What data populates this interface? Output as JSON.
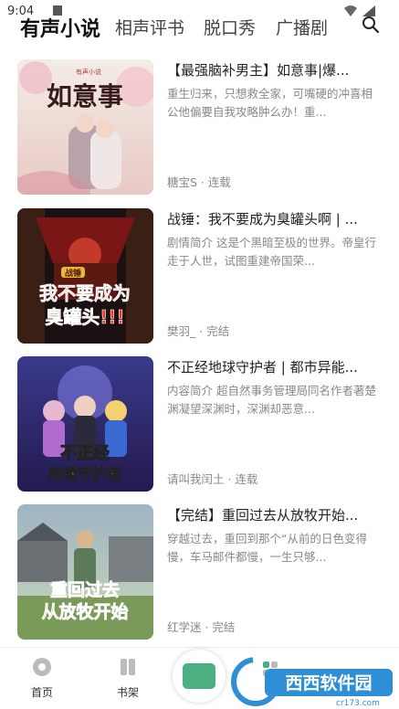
{
  "status_bar": {
    "time": "9:04"
  },
  "tabs": [
    {
      "label": "有声小说",
      "active": true
    },
    {
      "label": "相声评书",
      "active": false
    },
    {
      "label": "脱口秀",
      "active": false
    },
    {
      "label": "广播剧",
      "active": false
    }
  ],
  "books": [
    {
      "title": "【最强脑补男主】如意事|爆...",
      "description": "重生归来，只想救全家，可嘴硬的冲喜相公他偏要自我攻略肿么办！重...",
      "meta": "糖宝S · 连载",
      "cover_text": "如意事",
      "cover_tag": "有声小说"
    },
    {
      "title": "战锤：我不要成为臭罐头啊 | ...",
      "description": "剧情简介 这是个黑暗至极的世界。帝皇行走于人世，试图重建帝国荣...",
      "meta": "樊羽_ · 完结",
      "cover_text_top": "战锤",
      "cover_text_mid": "我不要成为",
      "cover_text_bottom": "臭罐头!!!"
    },
    {
      "title": "不正经地球守护者 | 都市异能...",
      "description": "内容简介 超自然事务管理局同名作者著楚渊凝望深渊时，深渊却恶意...",
      "meta": "请叫我闰土 · 连载",
      "cover_text_top": "不正经",
      "cover_text_bottom": "地球守护者"
    },
    {
      "title": "【完结】重回过去从放牧开始...",
      "description": "穿越过去，重回到那个“从前的日色变得慢，车马邮件都慢，一生只够...",
      "meta": "红学迷 · 完结",
      "cover_text_top": "重回过去",
      "cover_text_bottom": "从放牧开始"
    }
  ],
  "bottom_nav": {
    "home": "首页",
    "shelf": "书架"
  },
  "watermark": {
    "text": "西西软件园",
    "url": "cr173.com"
  },
  "colors": {
    "accent": "#4caf82",
    "watermark_blue": "#2f8fd6"
  }
}
